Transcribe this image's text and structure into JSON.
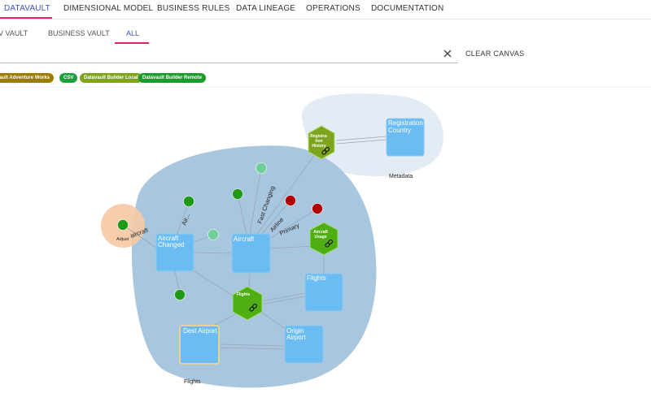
{
  "top_tabs": [
    "DATAVAULT",
    "DIMENSIONAL MODEL",
    "BUSINESS RULES",
    "DATA LINEAGE",
    "OPERATIONS",
    "DOCUMENTATION"
  ],
  "sub_tabs": [
    "V VAULT",
    "BUSINESS VAULT",
    "ALL"
  ],
  "search": {
    "value": ""
  },
  "clear_canvas_label": "CLEAR CANVAS",
  "chips": [
    {
      "label": "a Vault Adventure Works",
      "color": "#9a7d00"
    },
    {
      "label": "CSV",
      "color": "#1e9e3e"
    },
    {
      "label": "Datavault Builder Local",
      "color": "#7ea31c"
    },
    {
      "label": "Datavault Builder Remote",
      "color": "#1b9b2e"
    }
  ],
  "graph": {
    "groups": {
      "metadata": "Metadata",
      "flights": "Flights",
      "adjust": "Adjust"
    },
    "hubs": {
      "registration_country": "Registration Country",
      "aircraft_changed": "Aircraft Changed",
      "aircraft": "Aircraft",
      "flights": "Flights",
      "dest_airport": "Dest Airport",
      "origin_airport": "Origin Airport"
    },
    "links": {
      "registration_history": "Registra-tion History",
      "aircraft_usage": "Aircraft Usage",
      "flights": "Flights"
    },
    "edge_labels": {
      "fast_changing": "Fast Changing",
      "airline": "Airline",
      "primary": "Primary",
      "air": "Air...",
      "aircraft": "aircraft"
    }
  },
  "colors": {
    "accent": "#3f51b5",
    "underline": "#e91e63",
    "hub": "#6cbcf4",
    "link": "#56a81e",
    "sat_green": "#209a14",
    "sat_mint": "#6fcf9a",
    "sat_red": "#b00000",
    "flights_group": "#a9c6df",
    "metadata_group": "#e3ebf5",
    "adjust_group": "#f5c9a4"
  }
}
